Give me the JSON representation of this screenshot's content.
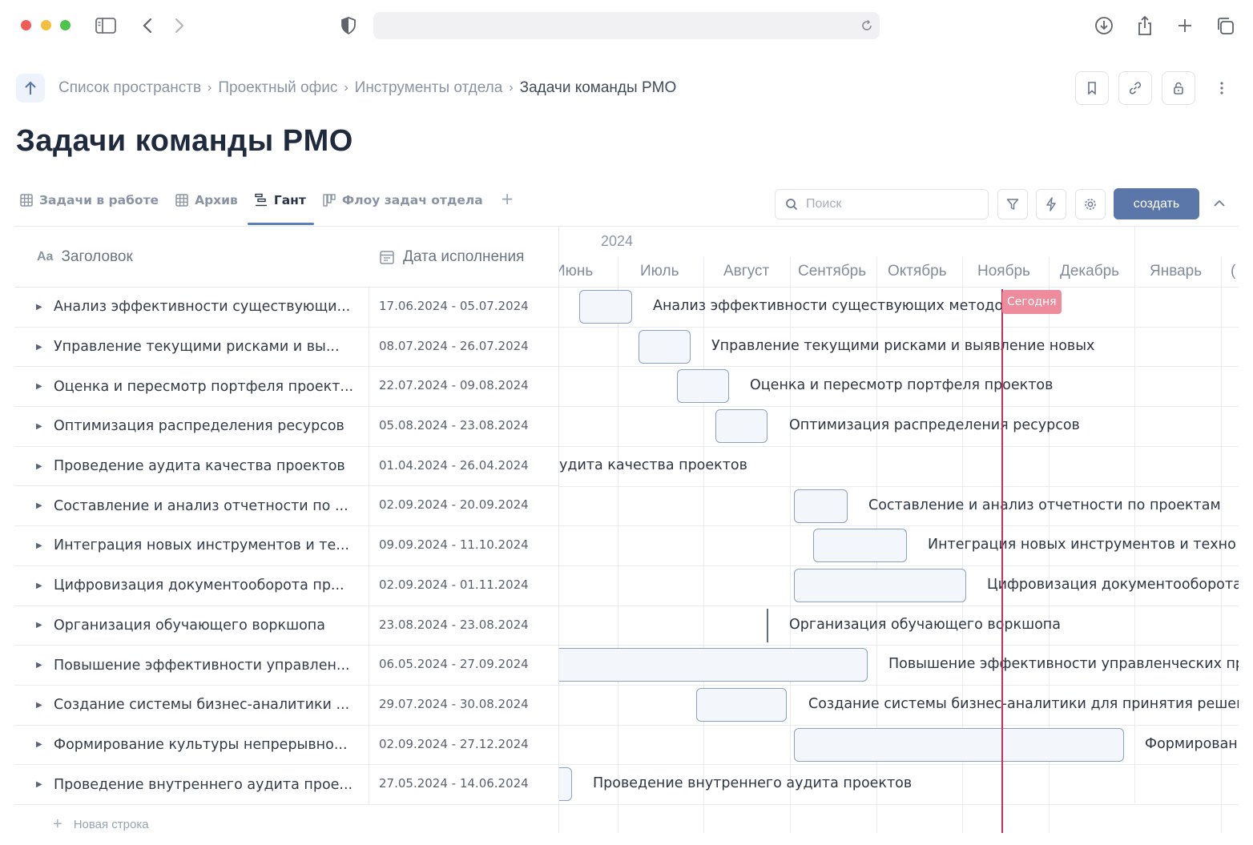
{
  "breadcrumb": {
    "items": [
      "Список пространств",
      "Проектный офис",
      "Инструменты отдела"
    ],
    "separator": "›",
    "current": "Задачи команды PMO"
  },
  "page_title": "Задачи команды PMO",
  "tabs": [
    {
      "label": "Задачи в работе",
      "icon": "grid-icon",
      "active": false
    },
    {
      "label": "Архив",
      "icon": "grid-icon",
      "active": false
    },
    {
      "label": "Гант",
      "icon": "gantt-icon",
      "active": true
    },
    {
      "label": "Флоу задач отдела",
      "icon": "board-icon",
      "active": false
    }
  ],
  "tab_add": "+",
  "search": {
    "placeholder": "Поиск",
    "value": ""
  },
  "create_label": "создать",
  "table": {
    "col_title": "Заголовок",
    "col_title_icon": "Aa",
    "col_date": "Дата исполнения",
    "rows": [
      {
        "title": "Анализ эффективности существующих методологий",
        "title_display": "Анализ эффективности существующи...",
        "dates": "17.06.2024 - 05.07.2024"
      },
      {
        "title": "Управление текущими рисками и выявление новых",
        "title_display": "Управление текущими рисками и вы...",
        "dates": "08.07.2024 - 26.07.2024"
      },
      {
        "title": "Оценка и пересмотр портфеля проектов",
        "title_display": "Оценка и пересмотр портфеля проект...",
        "dates": "22.07.2024 - 09.08.2024"
      },
      {
        "title": "Оптимизация распределения ресурсов",
        "title_display": "Оптимизация распределения ресурсов",
        "dates": "05.08.2024 - 23.08.2024"
      },
      {
        "title": "Проведение аудита качества проектов",
        "title_display": "Проведение аудита качества проектов",
        "dates": "01.04.2024 - 26.04.2024"
      },
      {
        "title": "Составление и анализ отчетности по проектам",
        "title_display": "Составление и анализ отчетности по ...",
        "dates": "02.09.2024 - 20.09.2024"
      },
      {
        "title": "Интеграция новых инструментов и технологий",
        "title_display": "Интеграция новых инструментов и те...",
        "dates": "09.09.2024 - 11.10.2024"
      },
      {
        "title": "Цифровизация документооборота проектов",
        "title_display": "Цифровизация документооборота пр...",
        "dates": "02.09.2024 - 01.11.2024"
      },
      {
        "title": "Организация обучающего воркшопа",
        "title_display": "Организация обучающего воркшопа",
        "dates": "23.08.2024 - 23.08.2024"
      },
      {
        "title": "Повышение эффективности управленческих процессов",
        "title_display": "Повышение эффективности управлен...",
        "dates": "06.05.2024 - 27.09.2024"
      },
      {
        "title": "Создание системы бизнес-аналитики для принятия решений",
        "title_display": "Создание системы бизнес-аналитики ...",
        "dates": "29.07.2024 - 30.08.2024"
      },
      {
        "title": "Формирование культуры непрерывного улучшения",
        "title_display": "Формирование культуры непрерывно...",
        "dates": "02.09.2024 - 27.12.2024"
      },
      {
        "title": "Проведение внутреннего аудита проектов",
        "title_display": "Проведение внутреннего аудита прое...",
        "dates": "27.05.2024 - 14.06.2024"
      }
    ],
    "new_row": "Новая строка"
  },
  "gantt": {
    "year": "2024",
    "months": [
      "Июнь",
      "Июль",
      "Август",
      "Сентябрь",
      "Октябрь",
      "Ноябрь",
      "Декабрь",
      "Январь"
    ],
    "today_label": "Сегодня",
    "today_date": "2024-11-21",
    "bar_labels": [
      "Анализ эффективности существующих методологий",
      "Управление текущими рисками и выявление новых",
      "Оценка и пересмотр портфеля проектов",
      "Оптимизация распределения ресурсов",
      "удита качества проектов",
      "Составление и анализ отчетности по проектам",
      "Интеграция новых инструментов и техно",
      "Цифровизация документооборота",
      "Организация обучающего воркшопа",
      "Повышение эффективности управленческих пр",
      "Создание системы бизнес-аналитики для принятия решен",
      "Формирован",
      "Проведение внутреннего аудита проектов"
    ]
  },
  "colors": {
    "accent": "#5b76a8",
    "today": "#c1325a",
    "today_badge": "#ee8c9e",
    "tab_underline": "#5b7ec2"
  }
}
